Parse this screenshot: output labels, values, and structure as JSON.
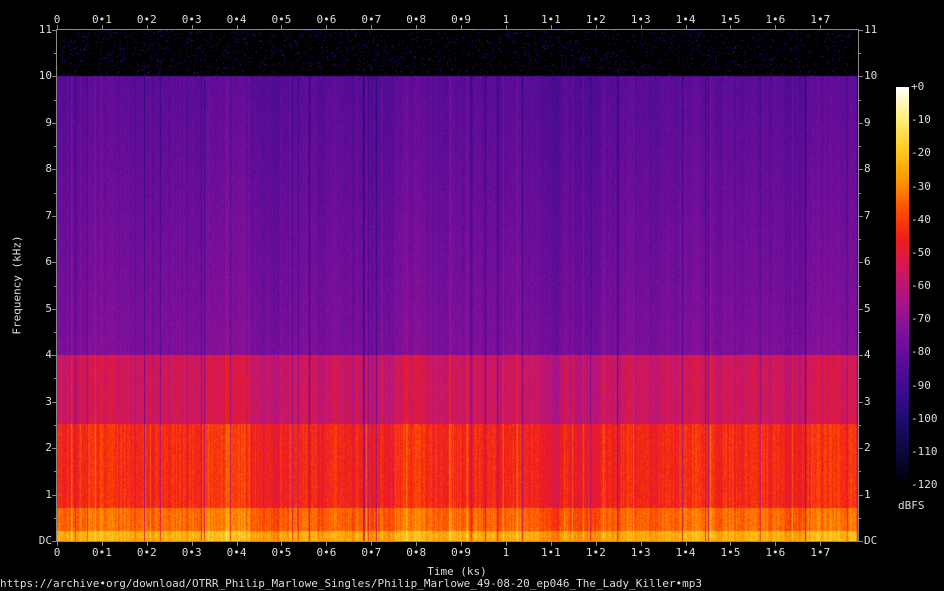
{
  "chart_data": {
    "type": "heatmap",
    "kind": "spectrogram",
    "xlabel": "Time (ks)",
    "ylabel": "Frequency (kHz)",
    "colorbar_label": "dBFS",
    "xlim": [
      0,
      1.784
    ],
    "ylim": [
      0,
      11
    ],
    "zlim": [
      -120,
      0
    ],
    "x_ticks": [
      0,
      0.1,
      0.2,
      0.3,
      0.4,
      0.5,
      0.6,
      0.7,
      0.8,
      0.9,
      1.0,
      1.1,
      1.2,
      1.3,
      1.4,
      1.5,
      1.6,
      1.7
    ],
    "x_tick_labels": [
      "0",
      "0•1",
      "0•2",
      "0•3",
      "0•4",
      "0•5",
      "0•6",
      "0•7",
      "0•8",
      "0•9",
      "1",
      "1•1",
      "1•2",
      "1•3",
      "1•4",
      "1•5",
      "1•6",
      "1•7"
    ],
    "y_ticks": [
      0,
      1,
      2,
      3,
      4,
      5,
      6,
      7,
      8,
      9,
      10,
      11
    ],
    "y_tick_labels": [
      "DC",
      "1",
      "2",
      "3",
      "4",
      "5",
      "6",
      "7",
      "8",
      "9",
      "10",
      "11"
    ],
    "colorbar_ticks": [
      0,
      -10,
      -20,
      -30,
      -40,
      -50,
      -60,
      -70,
      -80,
      -90,
      -100,
      -110,
      -120
    ],
    "colorbar_tick_labels": [
      "+0",
      "-10",
      "-20",
      "-30",
      "-40",
      "-50",
      "-60",
      "-70",
      "-80",
      "-90",
      "-100",
      "-110",
      "-120"
    ],
    "colormap": [
      "#000000",
      "#0a0838",
      "#1c0c6a",
      "#3a0c8c",
      "#5a0c98",
      "#80109a",
      "#a8148a",
      "#d0185c",
      "#f01c1c",
      "#ff5000",
      "#ff9a00",
      "#ffcc22",
      "#fff07a",
      "#ffffff"
    ],
    "level_profile_dBFS": [
      {
        "band_kHz": [
          0,
          0.2
        ],
        "level": -25
      },
      {
        "band_kHz": [
          0.2,
          0.7
        ],
        "level": -35
      },
      {
        "band_kHz": [
          0.7,
          2.5
        ],
        "level": -45
      },
      {
        "band_kHz": [
          2.5,
          4
        ],
        "level": -57
      },
      {
        "band_kHz": [
          4,
          10
        ],
        "level": -75
      },
      {
        "band_kHz": [
          10,
          11
        ],
        "level": -120
      }
    ]
  },
  "footer": {
    "source": "https://archive•org/download/OTRR_Philip_Marlowe_Singles/Philip_Marlowe_49-08-20_ep046_The_Lady_Killer•mp3"
  }
}
